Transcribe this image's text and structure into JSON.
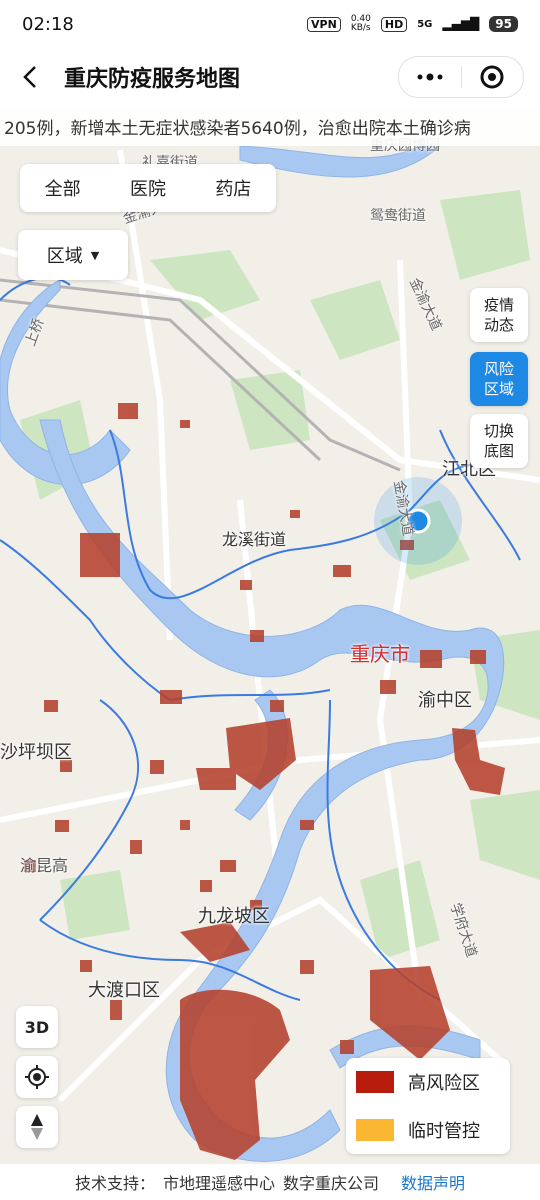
{
  "status_bar": {
    "time": "02:18",
    "vpn": "VPN",
    "speed": "0.40\nKB/s",
    "hd": "HD",
    "network": "5G",
    "battery": "95"
  },
  "header": {
    "title": "重庆防疫服务地图",
    "back_icon": "back-arrow-icon",
    "more_icon": "more-dots-icon",
    "target_icon": "target-icon"
  },
  "ticker": {
    "text": "205例，新增本土无症状感染者5640例，治愈出院本土确诊病"
  },
  "category_tabs": [
    "全部",
    "医院",
    "药店"
  ],
  "region_button": {
    "label": "区域",
    "icon": "caret-down-icon"
  },
  "side_buttons": [
    {
      "label": "疫情\n动态",
      "active": false
    },
    {
      "label": "风险\n区域",
      "active": true
    },
    {
      "label": "切换\n底图",
      "active": false
    }
  ],
  "map_labels": {
    "lijia": "礼嘉街道",
    "yuanyang": "鸳鸯街道",
    "jinyu1": "金渝大道",
    "jinyu2": "金渝大道",
    "jinyu3": "金渝大道",
    "expo": "重庆园博园",
    "jiangbei": "江北区",
    "longxi": "龙溪街道",
    "chongqing": "重庆市",
    "yuzhong": "渝中区",
    "shapingba": "沙坪坝区",
    "yukun": "渝昆高",
    "jiulongpo": "九龙坡区",
    "dadukou": "大渡口区",
    "xuefu": "学府大道",
    "shangqiao": "上桥"
  },
  "map_tools": {
    "three_d": "3D",
    "locate_icon": "locate-icon",
    "compass_icon": "compass-icon"
  },
  "legend": [
    {
      "label": "高风险区",
      "color": "#b71c0c"
    },
    {
      "label": "临时管控",
      "color": "#fbb731"
    }
  ],
  "colors": {
    "river": "#a8c8f2",
    "boundary": "#3b7be0",
    "risk": "#b5412e",
    "park": "#cde6c1",
    "accent": "#1e88e5"
  },
  "footer": {
    "prefix": "技术支持：",
    "org1": "市地理遥感中心",
    "org2": "数字重庆公司",
    "link": "数据声明"
  }
}
